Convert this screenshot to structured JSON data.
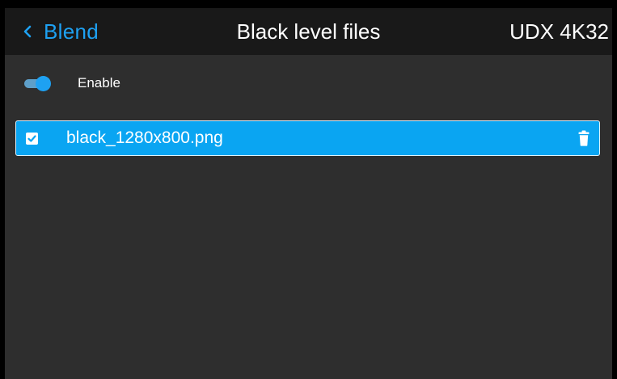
{
  "header": {
    "back_label": "Blend",
    "title": "Black level files",
    "device": "UDX 4K32",
    "back_icon": "chevron-left-icon",
    "accent_color": "#1ea1f2"
  },
  "enable": {
    "label": "Enable",
    "state": "on",
    "icon": "toggle-switch-icon"
  },
  "files": [
    {
      "name": "black_1280x800.png",
      "checked": true,
      "selected": true,
      "delete_icon": "trash-icon",
      "highlight_color": "#0aa5f2"
    }
  ],
  "colors": {
    "background": "#2e2e2e",
    "header_background": "#191919",
    "text": "#ffffff"
  }
}
